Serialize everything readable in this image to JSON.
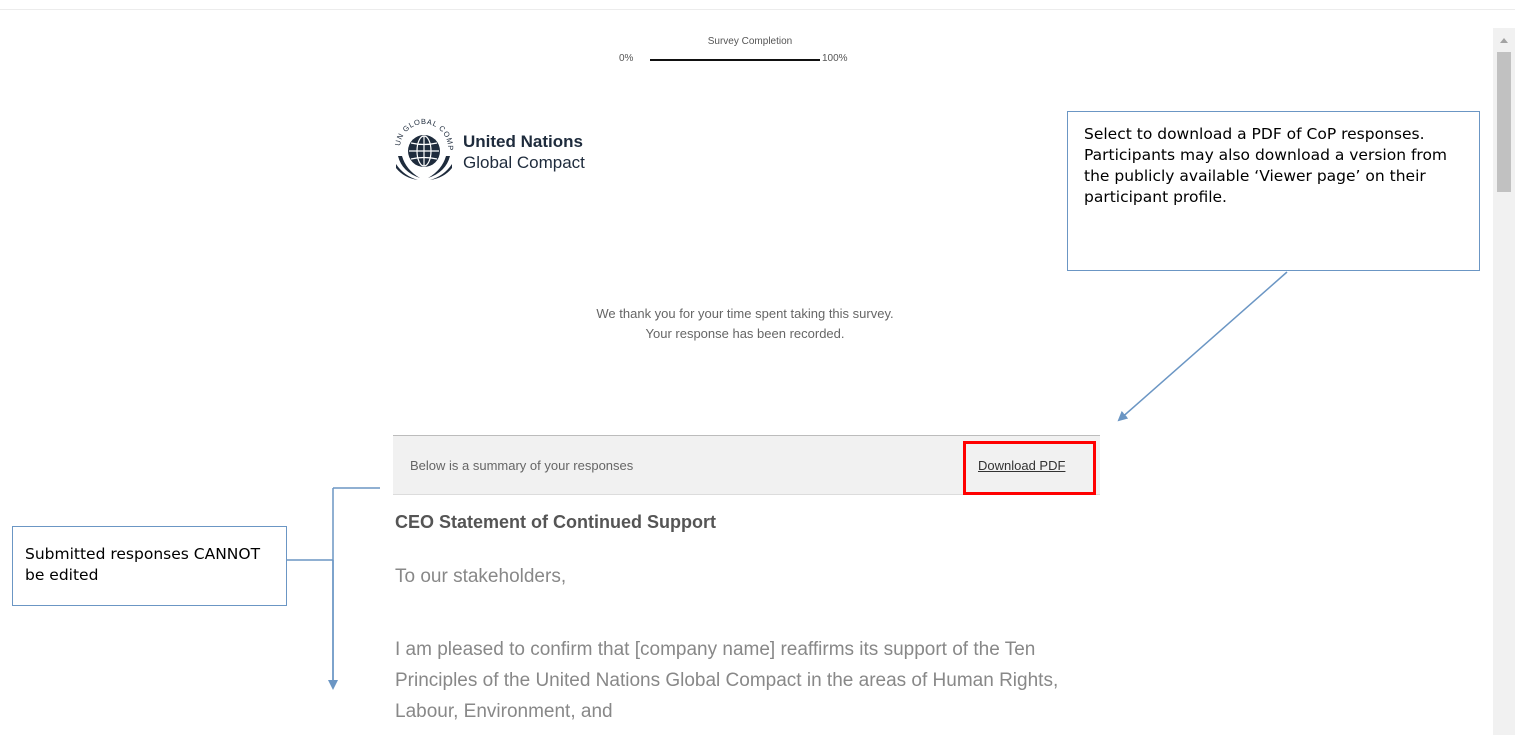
{
  "progress": {
    "title": "Survey Completion",
    "start_label": "0%",
    "end_label": "100%",
    "value": 1.0
  },
  "logo": {
    "line1": "United Nations",
    "line2": "Global Compact",
    "emblem_text": "UN GLOBAL COMPACT"
  },
  "thanks": {
    "line1": "We thank you for your time spent taking this survey.",
    "line2": "Your response has been recorded."
  },
  "summary": {
    "text": "Below is a summary of your responses",
    "download_label": "Download PDF"
  },
  "content": {
    "heading": "CEO Statement of Continued Support",
    "greeting": "To our stakeholders,",
    "paragraph": "I am pleased to confirm that [company name] reaffirms its support of the Ten Principles of the United Nations Global Compact in the areas of Human Rights, Labour, Environment, and"
  },
  "callouts": {
    "pdf": "Select to download a PDF of CoP responses. Participants may also download a version from the publicly available ‘Viewer page’ on their participant profile.",
    "edit": "Submitted responses CANNOT be edited"
  },
  "colors": {
    "highlight": "#ff0000",
    "callout_border": "#6b96c4",
    "progress_fill": "#111111"
  },
  "icons": {
    "scroll_up": "triangle-up-icon"
  }
}
